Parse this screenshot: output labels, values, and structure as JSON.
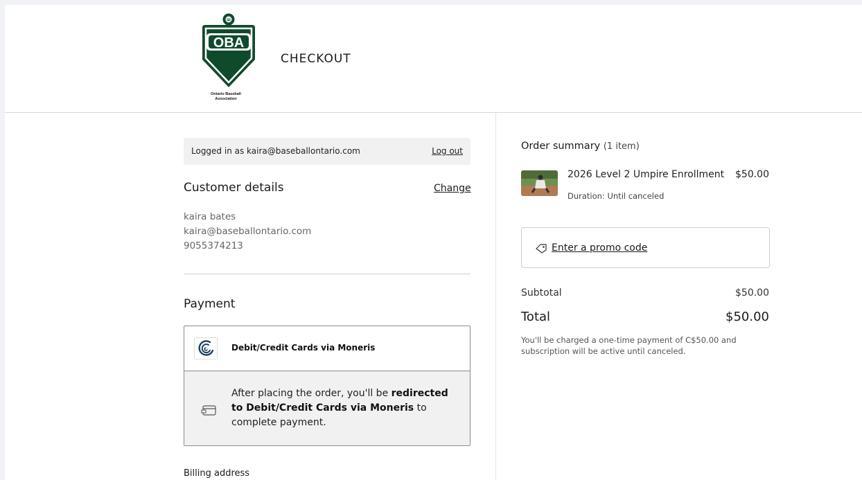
{
  "header": {
    "logo_text": "OBA",
    "logo_caption_line1": "Ontario Baseball",
    "logo_caption_line2": "Association",
    "title": "CHECKOUT"
  },
  "account": {
    "logged_in_text": "Logged in as kaira@baseballontario.com",
    "logout_label": "Log out"
  },
  "customer": {
    "heading": "Customer details",
    "change_label": "Change",
    "name": "kaira bates",
    "email": "kaira@baseballontario.com",
    "phone": "9055374213"
  },
  "payment": {
    "heading": "Payment",
    "method_name": "Debit/Credit Cards via Moneris",
    "message_part1": "After placing the order, you'll be ",
    "message_bold1": "redirected to Debit/Credit Cards via Moneris",
    "message_part2": " to complete payment."
  },
  "billing": {
    "heading": "Billing address"
  },
  "summary": {
    "title": "Order summary",
    "count": "(1 item)",
    "item": {
      "name": "2026 Level 2 Umpire Enrollment",
      "price": "$50.00",
      "duration": "Duration: Until canceled"
    },
    "promo_label": "Enter a promo code",
    "subtotal_label": "Subtotal",
    "subtotal_value": "$50.00",
    "total_label": "Total",
    "total_value": "$50.00",
    "charge_note": "You'll be charged a one-time payment of C$50.00 and subscription will be active until canceled."
  },
  "colors": {
    "logo_green": "#0f4a2c",
    "page_background": "#ffffff",
    "panel_gray": "#f1f1f1"
  },
  "icons": [
    "baseball-icon",
    "moneris-logo-icon",
    "card-icon",
    "tag-icon"
  ]
}
